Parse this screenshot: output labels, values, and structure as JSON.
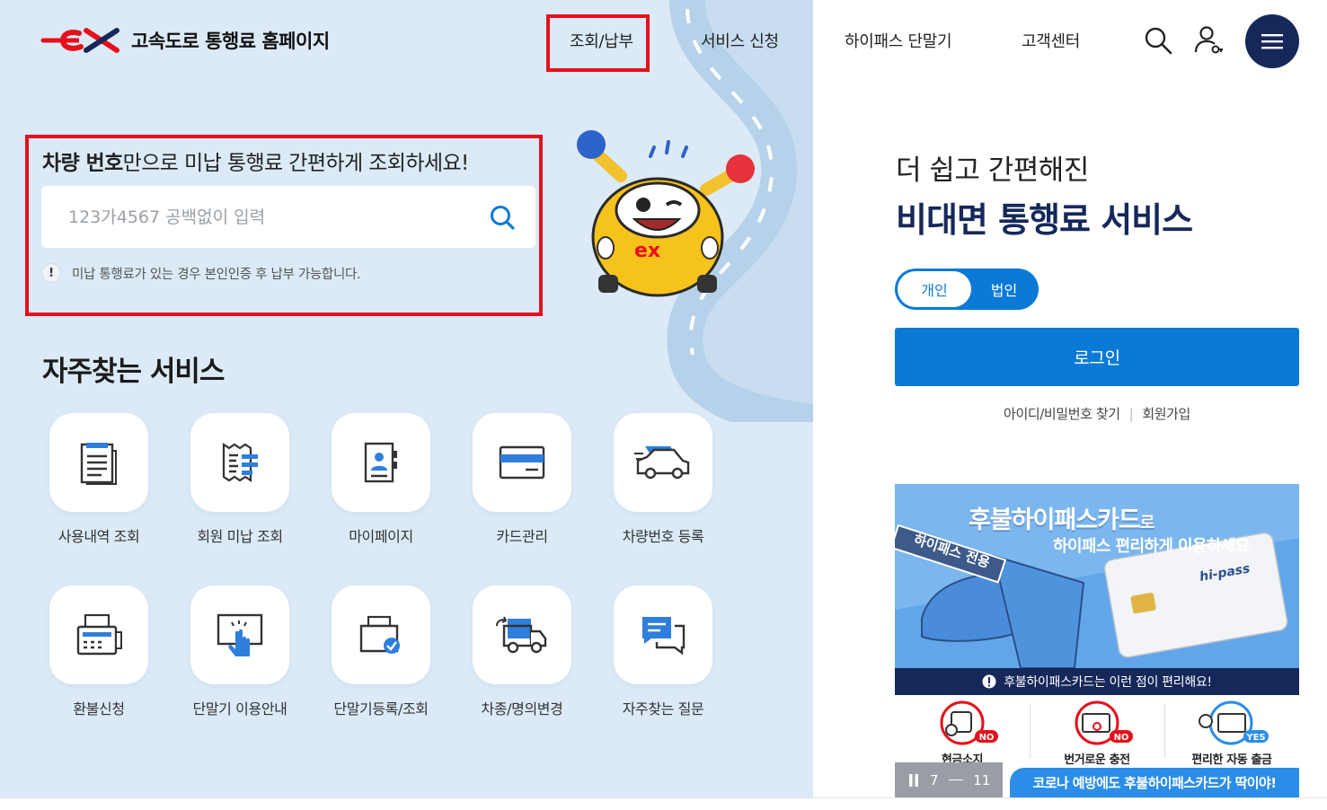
{
  "header": {
    "site_title": "고속도로 통행료 홈페이지",
    "nav": [
      "조회/납부",
      "서비스 신청",
      "하이패스 단말기",
      "고객센터"
    ]
  },
  "search": {
    "title_bold": "차량 번호",
    "title_rest": "만으로 미납 통행료 간편하게 조회하세요!",
    "placeholder": "123가4567 공백없이 입력",
    "notice_mark": "!",
    "notice": "미납 통행료가 있는 경우 본인인증 후 납부 가능합니다."
  },
  "services": {
    "title": "자주찾는 서비스",
    "items": [
      {
        "label": "사용내역 조회",
        "icon": "document-list-icon"
      },
      {
        "label": "회원 미납 조회",
        "icon": "receipt-icon"
      },
      {
        "label": "마이페이지",
        "icon": "user-profile-icon"
      },
      {
        "label": "카드관리",
        "icon": "credit-card-icon"
      },
      {
        "label": "차량번호 등록",
        "icon": "car-icon"
      },
      {
        "label": "환불신청",
        "icon": "fax-machine-icon"
      },
      {
        "label": "단말기 이용안내",
        "icon": "touch-screen-icon"
      },
      {
        "label": "단말기등록/조회",
        "icon": "device-check-icon"
      },
      {
        "label": "차종/명의변경",
        "icon": "truck-change-icon"
      },
      {
        "label": "자주찾는 질문",
        "icon": "chat-bubble-icon"
      }
    ]
  },
  "login_panel": {
    "subtitle": "더 쉽고 간편해진",
    "title": "비대면 통행료 서비스",
    "toggle": {
      "active": "개인",
      "inactive": "법인"
    },
    "login_button": "로그인",
    "find_link": "아이디/비밀번호 찾기",
    "separator": "|",
    "join_link": "회원가입"
  },
  "banner": {
    "headline": "후불하이패스카드",
    "headline_suffix": "로",
    "subline": "하이패스 편리하게 이용하세요",
    "sign_text": "하이패스 전용",
    "card_brand": "hi-pass",
    "strip_text": "후불하이패스카드는 이런 점이 편리해요!",
    "features": [
      {
        "label": "현금소지",
        "badge": "NO"
      },
      {
        "label": "번거로운 충전",
        "badge": "NO"
      },
      {
        "label": "편리한 자동 출금",
        "badge": "YES"
      }
    ],
    "pager": {
      "current": "7",
      "total": "11",
      "pause_icon": "pause-icon"
    },
    "caption": "코로나 예방에도 후불하이패스카드가 딱이야!"
  },
  "colors": {
    "brand_navy": "#16285a",
    "brand_blue": "#0b7ad6",
    "brand_red": "#e5101c",
    "left_bg": "#dbeaf6",
    "highlight_box": "#e5101c"
  }
}
